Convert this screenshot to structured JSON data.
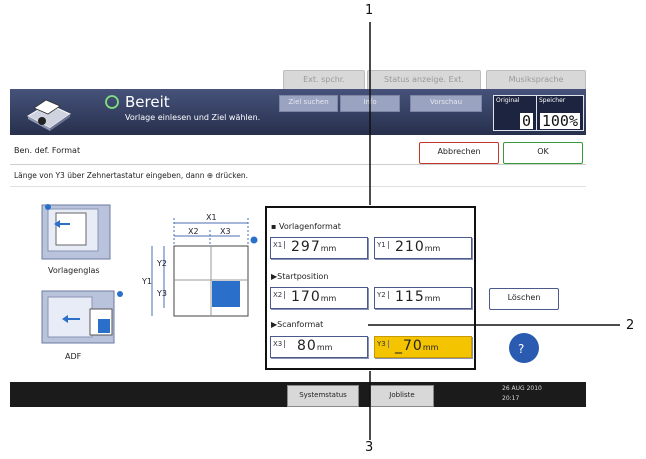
{
  "top_buttons": [
    "Ext. spchr.",
    "Status anzeige. Ext.",
    "Musiksprache"
  ],
  "status": {
    "title": "Bereit",
    "subtitle": "Vorlage einlesen und Ziel wählen."
  },
  "header_buttons": [
    "Ziel suchen",
    "Info",
    "Vorschau"
  ],
  "counters": [
    {
      "label": "Original",
      "value": "0"
    },
    {
      "label": "Speicher",
      "value": "100%"
    }
  ],
  "screen_title": "Ben. def. Format",
  "cancel_label": "Abbrechen",
  "ok_label": "OK",
  "instruction": "Länge von Y3 über Zehnertastatur eingeben, dann ⊕ drücken.",
  "originals": [
    {
      "label": "Vorlagenglas"
    },
    {
      "label": "ADF"
    }
  ],
  "diagram": {
    "x1": "X1",
    "x2": "X2",
    "x3": "X3",
    "y1": "Y1",
    "y2": "Y2",
    "y3": "Y3"
  },
  "sections": [
    {
      "label": "Vorlagenformat",
      "fields": [
        {
          "prefix": "X1",
          "value": "297",
          "unit": "mm"
        },
        {
          "prefix": "Y1",
          "value": "210",
          "unit": "mm"
        }
      ]
    },
    {
      "label": "Startposition",
      "fields": [
        {
          "prefix": "X2",
          "value": "170",
          "unit": "mm"
        },
        {
          "prefix": "Y2",
          "value": "115",
          "unit": "mm"
        }
      ]
    },
    {
      "label": "Scanformat",
      "fields": [
        {
          "prefix": "X3",
          "value": "80",
          "unit": "mm"
        },
        {
          "prefix": "Y3",
          "value": "_70",
          "unit": "mm"
        }
      ]
    }
  ],
  "loeschen_label": "Löschen",
  "bottom": {
    "systemstatus": "Systemstatus",
    "jobliste": "Jobliste",
    "datetime_line1": "26 AUG  2010",
    "datetime_line2": "20:17"
  },
  "callouts": [
    "1",
    "2",
    "3"
  ],
  "colors": {
    "header": "#2e3a5c",
    "active_field": "#f5c400",
    "cancel_border": "#c0392b",
    "ok_border": "#3a9a3a",
    "field_border": "#4b5a8a"
  }
}
